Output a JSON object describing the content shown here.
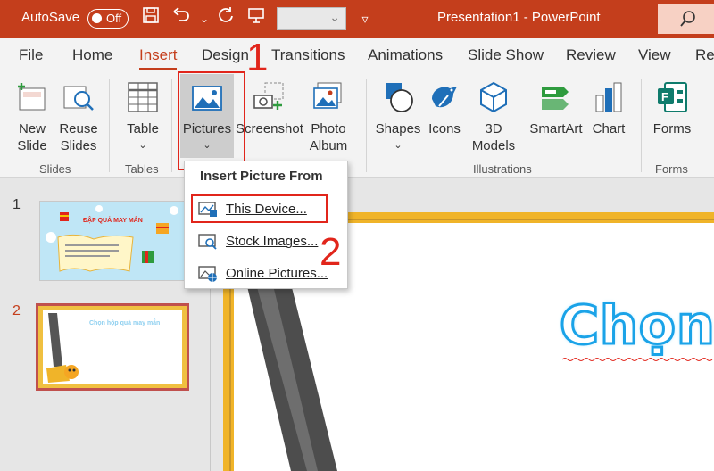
{
  "titlebar": {
    "autosave_label": "AutoSave",
    "autosave_state": "Off",
    "doc_title": "Presentation1  -  PowerPoint"
  },
  "tabs": [
    "File",
    "Home",
    "Insert",
    "Design",
    "Transitions",
    "Animations",
    "Slide Show",
    "Review",
    "View",
    "Rec"
  ],
  "active_tab": "Insert",
  "ribbon": {
    "new_slide": "New\nSlide",
    "reuse_slides": "Reuse\nSlides",
    "group_slides": "Slides",
    "table": "Table",
    "group_tables": "Tables",
    "pictures": "Pictures",
    "screenshot": "Screenshot",
    "photo_album": "Photo\nAlbum",
    "shapes": "Shapes",
    "icons": "Icons",
    "models_3d": "3D\nModels",
    "smartart": "SmartArt",
    "chart": "Chart",
    "group_illustrations": "Illustrations",
    "forms": "Forms",
    "group_forms": "Forms"
  },
  "dropdown": {
    "header": "Insert Picture From",
    "items": [
      "This Device...",
      "Stock Images...",
      "Online Pictures..."
    ]
  },
  "annotations": {
    "step1": "1",
    "step2": "2"
  },
  "thumbnails": {
    "slide1_num": "1",
    "slide2_num": "2",
    "slide1_title": "ĐẬP QUẢ MAY MẮN",
    "slide2_title": "Chọn hộp quà may mắn"
  },
  "slide": {
    "heading": "Chọn"
  },
  "colors": {
    "accent": "#c43e1c",
    "highlight": "#e1251b",
    "frame": "#f0b429"
  }
}
